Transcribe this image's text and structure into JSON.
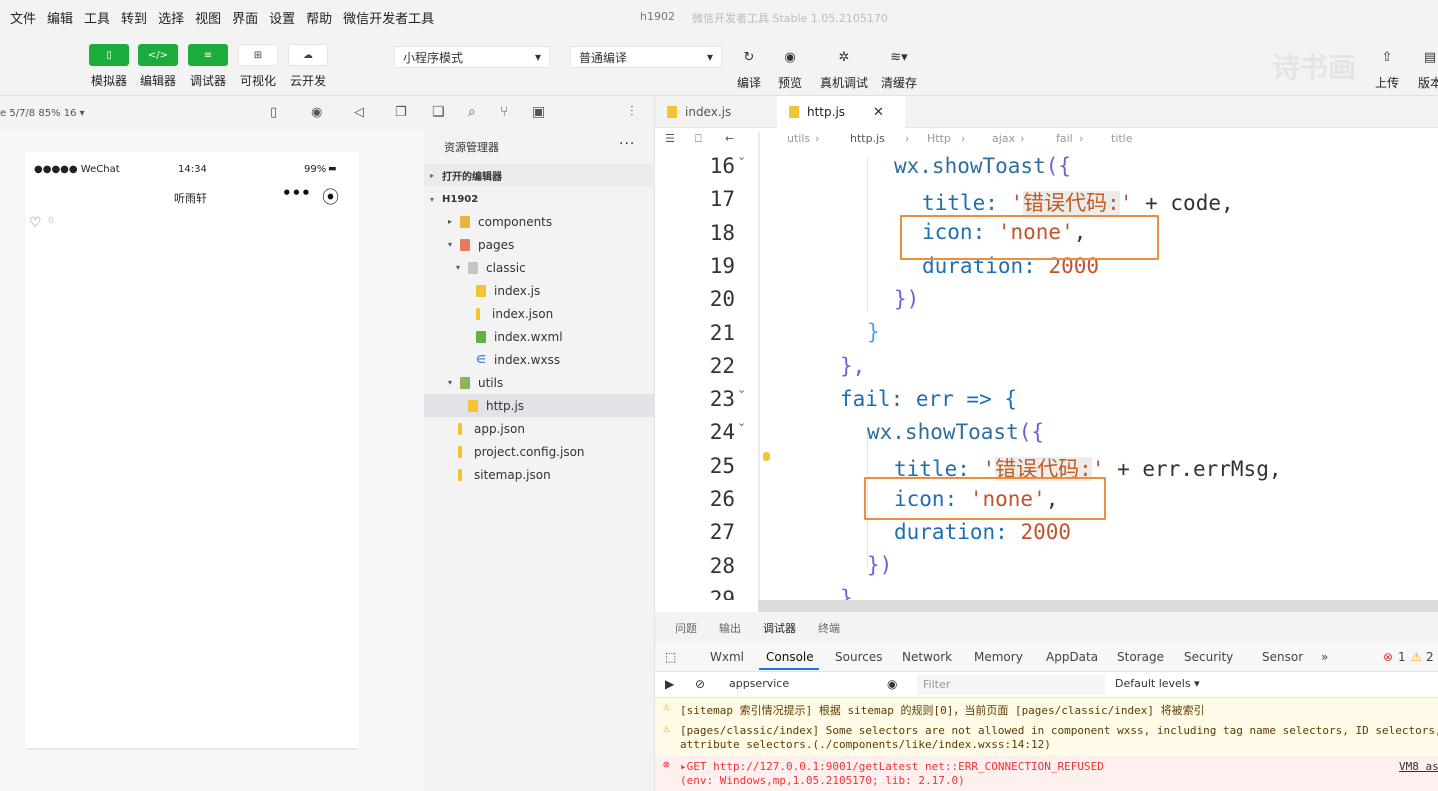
{
  "menu": [
    "文件",
    "编辑",
    "工具",
    "转到",
    "选择",
    "视图",
    "界面",
    "设置",
    "帮助",
    "微信开发者工具"
  ],
  "window_title": "h1902",
  "window_subtitle": "微信开发者工具 Stable 1.05.2105170",
  "toolbar": {
    "simulator": "模拟器",
    "editor": "编辑器",
    "debugger": "调试器",
    "visual": "可视化",
    "cloud": "云开发",
    "mode_select": "小程序模式",
    "compile_select": "普通编译",
    "compile": "编译",
    "preview": "预览",
    "real_debug": "真机调试",
    "clear_cache": "清缓存",
    "upload": "上传",
    "version": "版本",
    "watermark": "诗书画"
  },
  "simulator": {
    "info": "e 5/7/8 85% 16 ▾",
    "carrier": "●●●●● WeChat",
    "time": "14:34",
    "battery": "99%",
    "nav_title": "听雨轩",
    "like_count": "0"
  },
  "explorer": {
    "header": "资源管理器",
    "open_editors": "打开的编辑器",
    "project": "H1902",
    "items": [
      {
        "label": "components",
        "type": "folder-orange",
        "arrow": "▸",
        "indent": 24
      },
      {
        "label": "pages",
        "type": "folder-red",
        "arrow": "▾",
        "indent": 24
      },
      {
        "label": "classic",
        "type": "folder-gray",
        "arrow": "▾",
        "indent": 32
      },
      {
        "label": "index.js",
        "type": "js",
        "arrow": "",
        "indent": 52
      },
      {
        "label": "index.json",
        "type": "json",
        "arrow": "",
        "indent": 52
      },
      {
        "label": "index.wxml",
        "type": "wxml",
        "arrow": "",
        "indent": 52
      },
      {
        "label": "index.wxss",
        "type": "wxss",
        "arrow": "",
        "indent": 52
      },
      {
        "label": "utils",
        "type": "folder-green",
        "arrow": "▾",
        "indent": 24
      },
      {
        "label": "http.js",
        "type": "js",
        "arrow": "",
        "indent": 44,
        "selected": true
      },
      {
        "label": "app.json",
        "type": "json",
        "arrow": "",
        "indent": 34
      },
      {
        "label": "project.config.json",
        "type": "json",
        "arrow": "",
        "indent": 34
      },
      {
        "label": "sitemap.json",
        "type": "json",
        "arrow": "",
        "indent": 34
      }
    ]
  },
  "tabs": [
    {
      "label": "index.js",
      "active": false
    },
    {
      "label": "http.js",
      "active": true
    }
  ],
  "breadcrumb": [
    "utils",
    "http.js",
    "Http",
    "ajax",
    "fail",
    "title"
  ],
  "code_lines": [
    16,
    17,
    18,
    19,
    20,
    21,
    22,
    23,
    24,
    25,
    26,
    27,
    28,
    29
  ],
  "code": {
    "l16_fn": "wx.showToast",
    "l16_b": "({",
    "l17_k": "title: ",
    "l17_q1": "'",
    "l17_hl": "错误代码:",
    "l17_q2": "'",
    "l17_rest": " + code,",
    "l18_k": "icon: ",
    "l18_v": "'none'",
    "l18_c": ",",
    "l19_k": "duration: ",
    "l19_v": "2000",
    "l20": "})",
    "l21": "}",
    "l22": "},",
    "l23_k": "fail",
    "l23_r": ": err => {",
    "l24_fn": "wx.showToast",
    "l24_b": "({",
    "l25_k": "title: ",
    "l25_q1": "'",
    "l25_hl": "错误代码:",
    "l25_q2": "'",
    "l25_rest": " + err.errMsg,",
    "l26_k": "icon: ",
    "l26_v": "'none'",
    "l26_c": ",",
    "l27_k": "duration: ",
    "l27_v": "2000",
    "l28": "})",
    "l29": "}"
  },
  "devtools_top_tabs": [
    "问题",
    "输出",
    "调试器",
    "终端"
  ],
  "devtools_panels": [
    "Wxml",
    "Console",
    "Sources",
    "Network",
    "Memory",
    "AppData",
    "Storage",
    "Security",
    "Sensor",
    "»"
  ],
  "console": {
    "context": "appservice",
    "filter_placeholder": "Filter",
    "levels": "Default levels ▾",
    "err_count": "1",
    "warn_count": "2",
    "log1": "[sitemap 索引情况提示] 根据 sitemap 的规则[0]，当前页面 [pages/classic/index] 将被索引",
    "log2a": "[pages/classic/index] Some selectors are not allowed in component wxss, including tag name selectors, ID selectors, and",
    "log2b": "attribute selectors.(./components/like/index.wxss:14:12)",
    "log3a": "▸GET http://127.0.0.1:9001/getLatest net::ERR_CONNECTION_REFUSED",
    "log3b": "(env: Windows,mp,1.05.2105170; lib: 2.17.0)",
    "log3src": "VM8 as"
  }
}
